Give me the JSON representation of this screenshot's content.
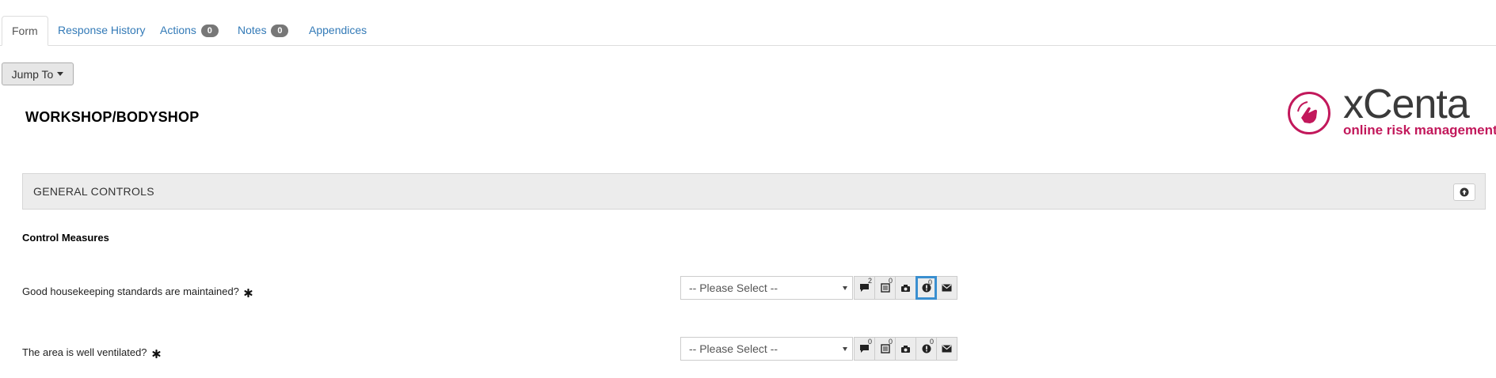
{
  "tabs": [
    {
      "label": "Form",
      "badge": null
    },
    {
      "label": "Response History",
      "badge": null
    },
    {
      "label": "Actions",
      "badge": "0"
    },
    {
      "label": "Notes",
      "badge": "0"
    },
    {
      "label": "Appendices",
      "badge": null
    }
  ],
  "jump_to": {
    "label": "Jump To",
    "icon": "caret-down-icon"
  },
  "page": {
    "title": "WORKSHOP/BODYSHOP"
  },
  "logo": {
    "name": "xCenta",
    "tagline": "online risk management",
    "color": "#c2185b"
  },
  "section": {
    "title": "GENERAL CONTROLS",
    "collapse_icon": "circle-arrow-up-icon"
  },
  "subheading": "Control Measures",
  "questions": [
    {
      "label": "Good housekeeping standards are maintained?",
      "required": true,
      "select_placeholder": "-- Please Select --",
      "tools": [
        {
          "name": "comment-icon",
          "count": "2"
        },
        {
          "name": "list-icon",
          "count": "0"
        },
        {
          "name": "camera-icon",
          "count": ""
        },
        {
          "name": "alert-icon",
          "count": "0"
        },
        {
          "name": "email-icon",
          "count": ""
        }
      ]
    },
    {
      "label": "The area is well ventilated?",
      "required": true,
      "select_placeholder": "-- Please Select --",
      "tools": [
        {
          "name": "comment-icon",
          "count": "0"
        },
        {
          "name": "list-icon",
          "count": "0"
        },
        {
          "name": "camera-icon",
          "count": ""
        },
        {
          "name": "alert-icon",
          "count": "0"
        },
        {
          "name": "email-icon",
          "count": ""
        }
      ]
    }
  ],
  "colors": {
    "link": "#337ab7",
    "highlight": "#3a8fd0",
    "badge": "#777777"
  }
}
